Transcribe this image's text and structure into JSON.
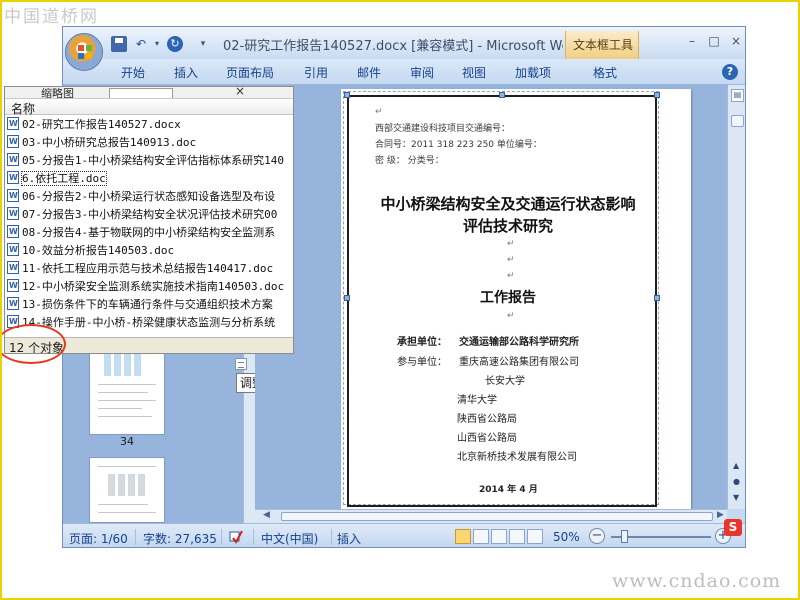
{
  "watermarks": {
    "top_left": "中国道桥网",
    "bottom_right": "www.cndao.com"
  },
  "window": {
    "title": "02-研究工作报告140527.docx [兼容模式] - Microsoft Wo...",
    "context_tab": "文本框工具",
    "controls": {
      "minimize": "–",
      "maximize": "□",
      "close": "×"
    }
  },
  "quick_access": {
    "undo": "↶",
    "undo_menu": "▾",
    "redo": "↻",
    "customize": "▾"
  },
  "ribbon": {
    "tabs": [
      "开始",
      "插入",
      "页面布局",
      "引用",
      "邮件",
      "审阅",
      "视图",
      "加载项",
      "格式"
    ],
    "help": "?"
  },
  "explorer": {
    "toolbar_label": "缩略图",
    "toolbar_close": "×",
    "column_header": "名称",
    "files": [
      "02-研究工作报告140527.docx",
      "03-中小桥研究总报告140913.doc",
      "05-分报告1-中小桥梁结构安全评估指标体系研究140",
      "6.依托工程.doc",
      "06-分报告2-中小桥梁运行状态感知设备选型及布设",
      "07-分报告3-中小桥梁结构安全状况评估技术研究00",
      "08-分报告4-基于物联网的中小桥梁结构安全监测系",
      "10-效益分析报告140503.doc",
      "11-依托工程应用示范与技术总结报告140417.doc",
      "12-中小桥梁安全监测系统实施技术指南140503.doc",
      "13-损伤条件下的车辆通行条件与交通组织技术方案",
      "14-操作手册-中小桥-桥梁健康状态监测与分析系统"
    ],
    "focused_index": 3,
    "status": "12 个对象"
  },
  "navigation": {
    "thumbnail_page_number": "34",
    "resize_tooltip": "调整大小"
  },
  "document": {
    "marks": {
      "para": "↵"
    },
    "top_lines": [
      "西部交通建设科技项目交通编号：",
      "合同号：2011 318 223 250 单位编号：",
      "密    级：     分类号："
    ],
    "title_line1": "中小桥梁结构安全及交通运行状态影响",
    "title_line2": "评估技术研究",
    "report_title": "工作报告",
    "undertaker_label": "承担单位：",
    "undertaker": "交通运输部公路科学研究所",
    "participants_label": "参与单位：",
    "participants": [
      "重庆高速公路集团有限公司",
      "长安大学",
      "清华大学",
      "陕西省公路局",
      "山西省公路局",
      "北京新桥技术发展有限公司"
    ],
    "date": "2014 年 4 月"
  },
  "status_bar": {
    "page": "页面: 1/60",
    "words": "字数: 27,635",
    "language": "中文(中国)",
    "mode": "插入",
    "zoom": "50%",
    "zoom_out": "−",
    "zoom_in": "+",
    "zoom_fraction": 0.5
  },
  "tray": {
    "ime": "S"
  },
  "colors": {
    "frame_border": "#e8d400",
    "ribbon_text": "#15428b",
    "context_tab": "#f0cf85",
    "annotation_circle": "#e03c1e"
  }
}
